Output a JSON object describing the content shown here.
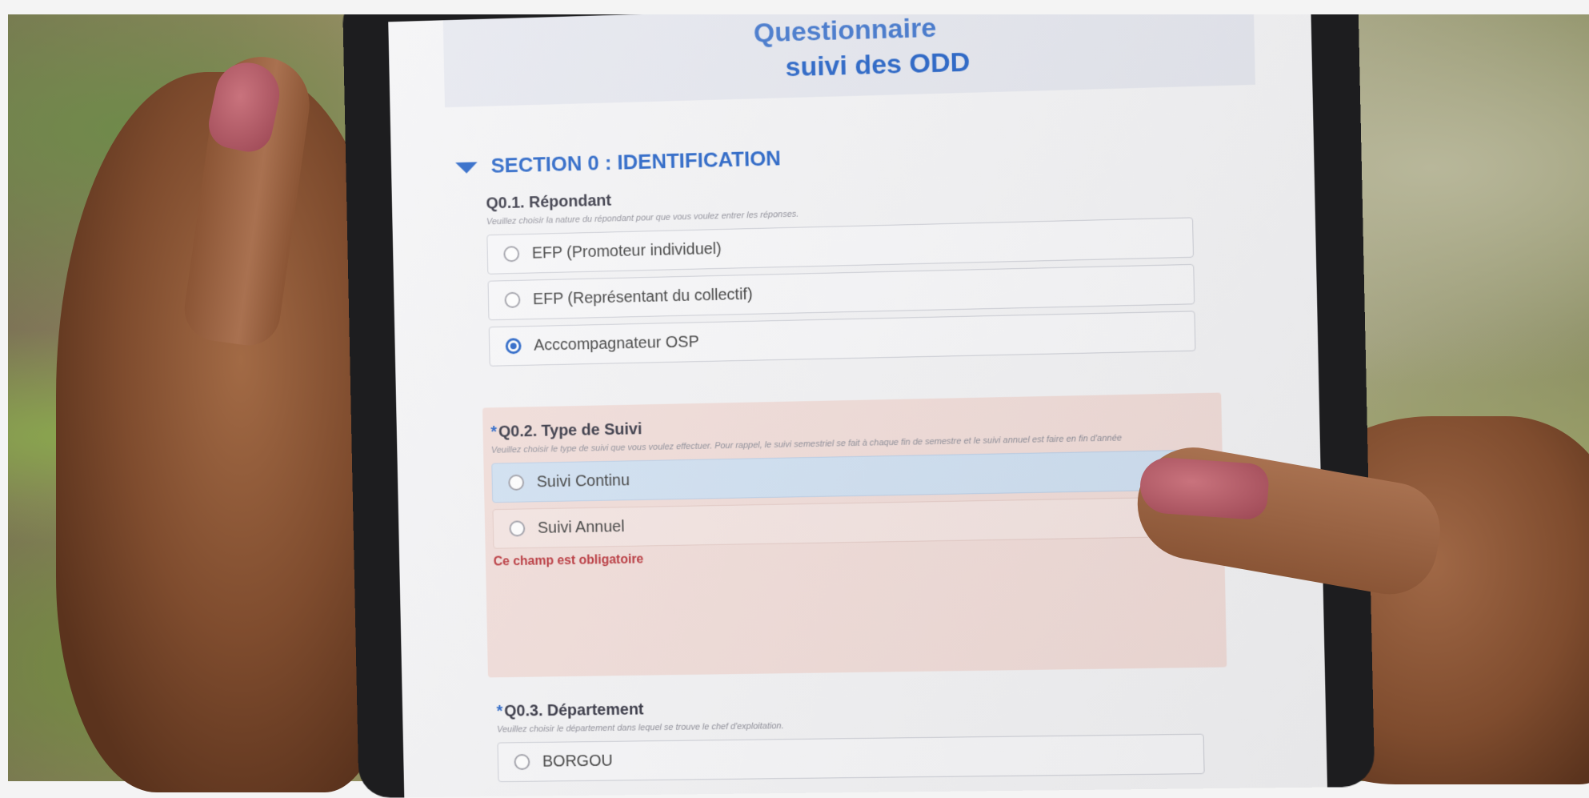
{
  "form": {
    "title_line1": "Questionnaire",
    "title_line2": "suivi des ODD"
  },
  "section": {
    "heading": "SECTION 0 : IDENTIFICATION"
  },
  "q1": {
    "title": "Q0.1. Répondant",
    "hint": "Veuillez choisir la nature du répondant pour que vous voulez entrer les réponses.",
    "options": [
      {
        "label": "EFP (Promoteur individuel)",
        "selected": false
      },
      {
        "label": "EFP (Représentant du collectif)",
        "selected": false
      },
      {
        "label": "Acccompagnateur OSP",
        "selected": true
      }
    ]
  },
  "q2": {
    "required_mark": "*",
    "title": "Q0.2. Type de Suivi",
    "hint": "Veuillez choisir le type de suivi que vous voulez effectuer. Pour rappel, le suivi semestriel se fait à chaque fin de semestre et le suivi annuel est faire en fin d'année",
    "options": [
      {
        "label": "Suivi Continu",
        "selected": false
      },
      {
        "label": "Suivi Annuel",
        "selected": false
      }
    ],
    "error": "Ce champ est obligatoire"
  },
  "q3": {
    "required_mark": "*",
    "title": "Q0.3. Département",
    "hint": "Veuillez choisir le département dans lequel se trouve le chef d'exploitation.",
    "options": [
      {
        "label": "BORGOU",
        "selected": false
      }
    ]
  },
  "colors": {
    "accent": "#1a5bc4",
    "error": "#b5282f",
    "error_bg": "#f1dcd8",
    "highlight": "#cfe0f2",
    "nail": "#b45a68"
  }
}
